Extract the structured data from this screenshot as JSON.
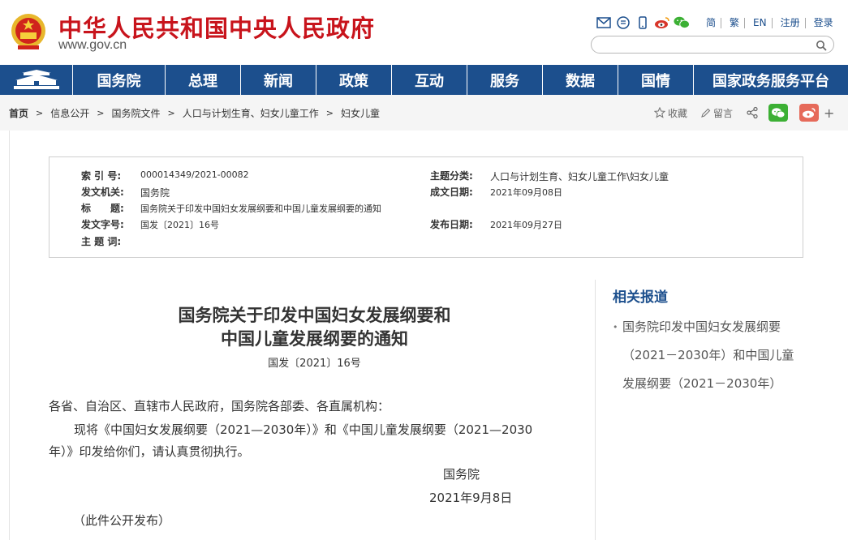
{
  "header": {
    "site_title": "中华人民共和国中央人民政府",
    "site_url": "www.gov.cn",
    "tools": [
      "简",
      "繁",
      "EN",
      "注册",
      "登录"
    ],
    "tool_icons": [
      "mail-icon",
      "feed-icon",
      "mobile-icon",
      "weibo-icon",
      "wechat-icon"
    ],
    "search_placeholder": ""
  },
  "nav": {
    "items": [
      "国务院",
      "总理",
      "新闻",
      "政策",
      "互动",
      "服务",
      "数据",
      "国情",
      "国家政务服务平台"
    ]
  },
  "breadcrumb": [
    "首页",
    "信息公开",
    "国务院文件",
    "人口与计划生育、妇女儿童工作",
    "妇女儿童"
  ],
  "share": {
    "favorite": "收藏",
    "comment": "留言"
  },
  "meta": {
    "index_label": "索 引 号:",
    "index_value": "000014349/2021-00082",
    "topic_label": "主题分类:",
    "topic_value": "人口与计划生育、妇女儿童工作\\妇女儿童",
    "issuer_label": "发文机关:",
    "issuer_value": "国务院",
    "date_label": "成文日期:",
    "date_value": "2021年09月08日",
    "title_label": "标　　题:",
    "title_value": "国务院关于印发中国妇女发展纲要和中国儿童发展纲要的通知",
    "docno_label": "发文字号:",
    "docno_value": "国发〔2021〕16号",
    "publish_label": "发布日期:",
    "publish_value": "2021年09月27日",
    "keywords_label": "主 题 词:"
  },
  "article": {
    "title_line1": "国务院关于印发中国妇女发展纲要和",
    "title_line2": "中国儿童发展纲要的通知",
    "doc_number": "国发〔2021〕16号",
    "salutation": "各省、自治区、直辖市人民政府，国务院各部委、各直属机构：",
    "para1_line1": "现将《中国妇女发展纲要（2021—2030年）》和《中国儿童发展纲要（2021—2030",
    "para1_line2": "年）》印发给你们，请认真贯彻执行。",
    "signature": "国务院",
    "sign_date": "2021年9月8日",
    "note": "（此件公开发布）"
  },
  "related": {
    "title": "相关报道",
    "items": [
      {
        "line1": "国务院印发中国妇女发展纲要",
        "line2": "（2021－2030年）和中国儿童",
        "line3": "发展纲要（2021－2030年）"
      }
    ]
  },
  "colors": {
    "brand_red": "#c8141c",
    "nav_blue": "#1c4f8d",
    "wechat_green": "#3cb034",
    "weibo_red": "#e66a5a"
  }
}
